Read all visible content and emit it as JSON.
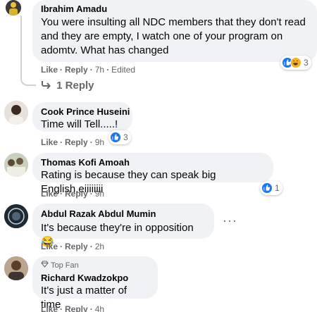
{
  "comments": [
    {
      "author": "Ibrahim Amadu",
      "text": "You were insulting all NDC members that they don't read and they are empty, I watch one of your program on adomtv. What has changed",
      "actions": {
        "like": "Like",
        "reply": "Reply",
        "time": "7h",
        "edited": "Edited"
      },
      "reactions": {
        "count": "3",
        "types": [
          "like-icon",
          "haha-icon"
        ]
      },
      "replies_label": "1 Reply"
    },
    {
      "author": "Cook Prince Huseini",
      "text": "Time will Tell.....!",
      "actions": {
        "like": "Like",
        "reply": "Reply",
        "time": "9h"
      },
      "reactions": {
        "count": "3",
        "types": [
          "like-icon"
        ]
      }
    },
    {
      "author": "Thomas Kofi Amoah",
      "text": "Rating is because they can speak big English,eiiiiiiii",
      "actions": {
        "like": "Like",
        "reply": "Reply",
        "time": "9h"
      },
      "reactions": {
        "count": "1",
        "types": [
          "like-icon"
        ]
      }
    },
    {
      "author": "Abdul Razak Abdul Mumin",
      "text": "It's because they're in opposition",
      "emoji": "😂",
      "actions": {
        "like": "Like",
        "reply": "Reply",
        "time": "2h"
      }
    },
    {
      "author": "Richard Kwadzokpo",
      "badge": "Top Fan",
      "text": "It's just a matter of time",
      "actions": {
        "like": "Like",
        "reply": "Reply",
        "time": "4h"
      }
    }
  ],
  "colors": {
    "like": "#1877f2",
    "haha": "#f7b125",
    "bubble": "#f0f2f5",
    "muted": "#65676b"
  }
}
